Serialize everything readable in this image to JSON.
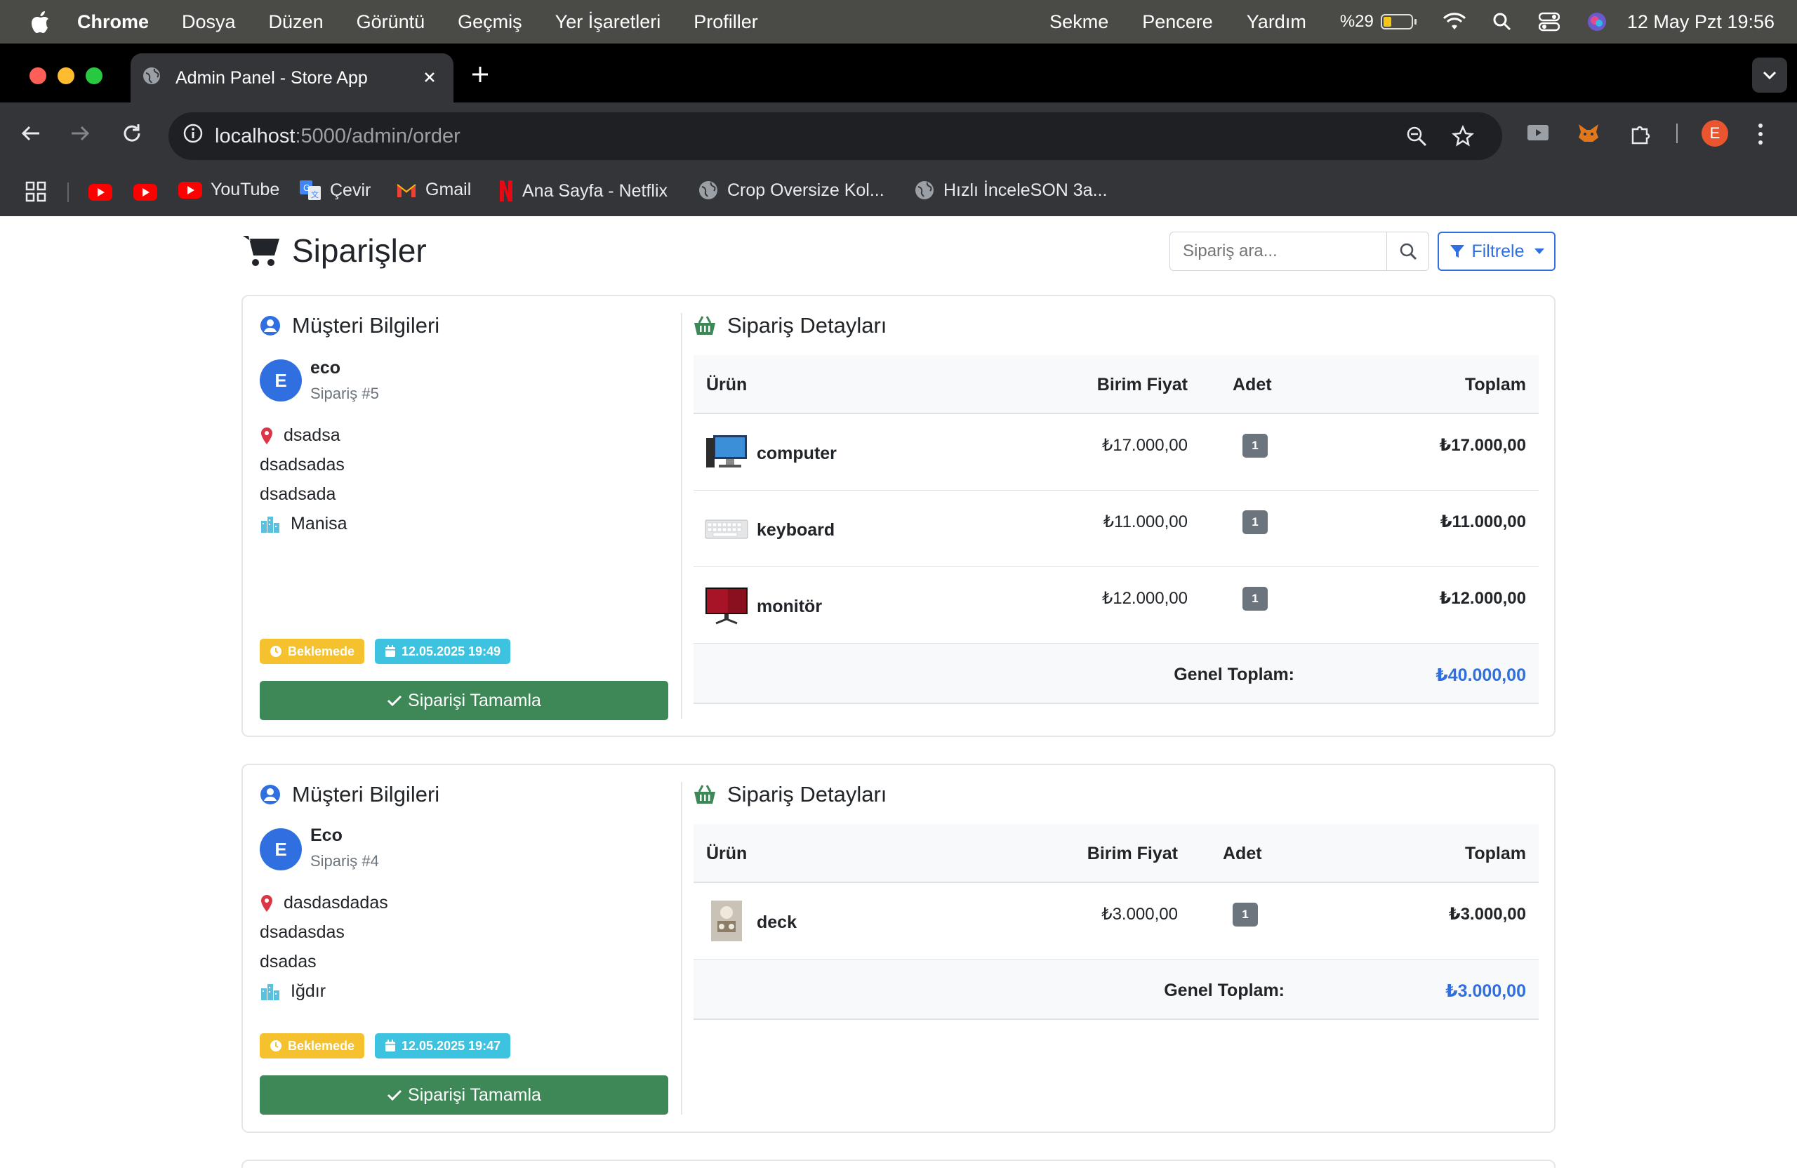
{
  "menubar": {
    "app": "Chrome",
    "items": [
      "Dosya",
      "Düzen",
      "Görüntü",
      "Geçmiş",
      "Yer İşaretleri",
      "Profiller"
    ],
    "right_items": [
      "Sekme",
      "Pencere",
      "Yardım"
    ],
    "battery": "%29",
    "battery_level": 0.29,
    "datetime": "12 May Pzt  19:56"
  },
  "browser": {
    "tab_title": "Admin Panel - Store App",
    "url_host": "localhost",
    "url_path": ":5000/admin/order",
    "profile_initial": "E",
    "bookmarks": [
      "YouTube",
      "Çevir",
      "Gmail",
      "Ana Sayfa - Netflix",
      "Crop Oversize Kol...",
      "Hızlı İnceleSON 3a..."
    ]
  },
  "page": {
    "title": "Siparişler",
    "search_placeholder": "Sipariş ara...",
    "filter_label": "Filtrele"
  },
  "orders": [
    {
      "customer_heading": "Müşteri Bilgileri",
      "details_heading": "Sipariş Detayları",
      "initial": "E",
      "name": "eco",
      "order_no": "Sipariş #5",
      "address_lines": [
        "dsadsa",
        "dsadsadas",
        "dsadsada"
      ],
      "city": "Manisa",
      "status": "Beklemede",
      "date": "12.05.2025 19:49",
      "complete_label": "Siparişi Tamamla",
      "table_headers": {
        "product": "Ürün",
        "unit_price": "Birim Fiyat",
        "qty": "Adet",
        "total": "Toplam"
      },
      "items": [
        {
          "name": "computer",
          "unit_price": "₺17.000,00",
          "qty": "1",
          "total": "₺17.000,00"
        },
        {
          "name": "keyboard",
          "unit_price": "₺11.000,00",
          "qty": "1",
          "total": "₺11.000,00"
        },
        {
          "name": "monitör",
          "unit_price": "₺12.000,00",
          "qty": "1",
          "total": "₺12.000,00"
        }
      ],
      "grand_label": "Genel Toplam:",
      "grand_total": "₺40.000,00"
    },
    {
      "customer_heading": "Müşteri Bilgileri",
      "details_heading": "Sipariş Detayları",
      "initial": "E",
      "name": "Eco",
      "order_no": "Sipariş #4",
      "address_lines": [
        "dasdasdadas",
        "dsadasdas",
        "dsadas"
      ],
      "city": "Iğdır",
      "status": "Beklemede",
      "date": "12.05.2025 19:47",
      "complete_label": "Siparişi Tamamla",
      "table_headers": {
        "product": "Ürün",
        "unit_price": "Birim Fiyat",
        "qty": "Adet",
        "total": "Toplam"
      },
      "items": [
        {
          "name": "deck",
          "unit_price": "₺3.000,00",
          "qty": "1",
          "total": "₺3.000,00"
        }
      ],
      "grand_label": "Genel Toplam:",
      "grand_total": "₺3.000,00"
    }
  ],
  "colors": {
    "primary": "#2f6fe0",
    "success": "#3e8757",
    "warning": "#f5c12e",
    "info": "#3dc2e0"
  }
}
